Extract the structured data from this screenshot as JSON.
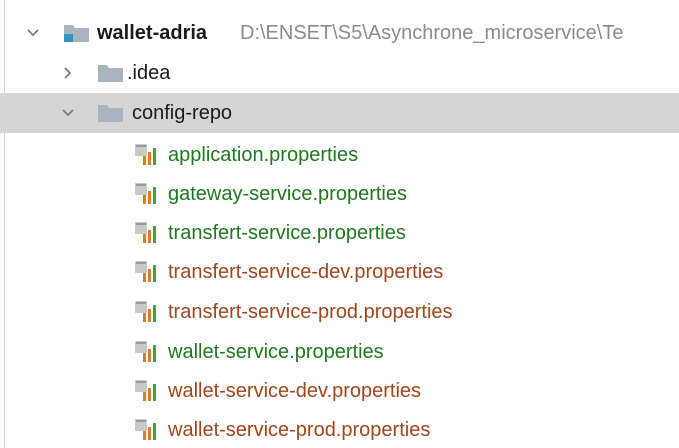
{
  "project": {
    "name": "wallet-adria",
    "path": "D:\\ENSET\\S5\\Asynchrone_microservice\\Te"
  },
  "folders": [
    {
      "label": ".idea",
      "expanded": false
    },
    {
      "label": "config-repo",
      "expanded": true
    }
  ],
  "files": [
    {
      "label": "application.properties",
      "color": "#1f7a1f"
    },
    {
      "label": "gateway-service.properties",
      "color": "#1f7a1f"
    },
    {
      "label": "transfert-service.properties",
      "color": "#1f7a1f"
    },
    {
      "label": "transfert-service-dev.properties",
      "color": "#a0461c"
    },
    {
      "label": "transfert-service-prod.properties",
      "color": "#a0461c"
    },
    {
      "label": "wallet-service.properties",
      "color": "#1f7a1f"
    },
    {
      "label": "wallet-service-dev.properties",
      "color": "#a0461c"
    },
    {
      "label": "wallet-service-prod.properties",
      "color": "#a0461c"
    }
  ],
  "icons": {
    "expanded": "chevron-down-icon",
    "collapsed": "chevron-right-icon",
    "module": "module-folder-icon",
    "folder": "folder-icon",
    "file": "properties-file-icon"
  },
  "colors": {
    "selection": "#d5d5d5",
    "folder": "#a9b4c0",
    "module_accent": "#3592c4"
  }
}
